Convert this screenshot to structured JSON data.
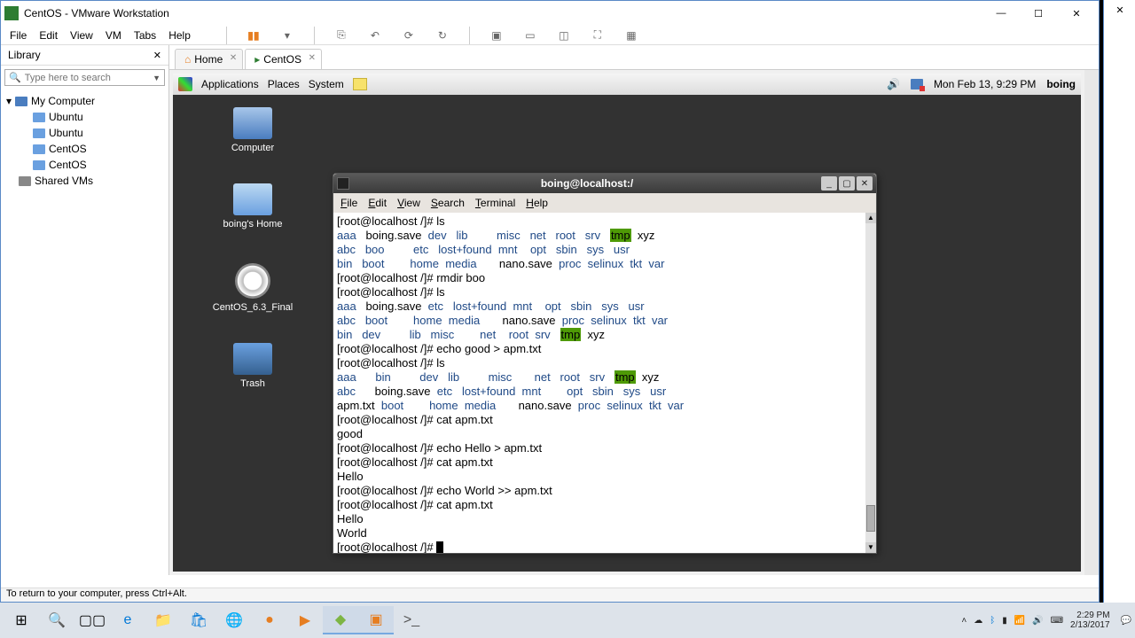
{
  "vmware": {
    "title": "CentOS - VMware Workstation",
    "menu": [
      "File",
      "Edit",
      "View",
      "VM",
      "Tabs",
      "Help"
    ],
    "status": "To return to your computer, press Ctrl+Alt."
  },
  "library": {
    "title": "Library",
    "search_placeholder": "Type here to search",
    "root": "My Computer",
    "items": [
      "Ubuntu",
      "Ubuntu",
      "CentOS",
      "CentOS",
      "Shared VMs"
    ]
  },
  "tabs": {
    "home": "Home",
    "active": "CentOS"
  },
  "gnome": {
    "apps": [
      "Applications",
      "Places",
      "System"
    ],
    "datetime": "Mon Feb 13,  9:29 PM",
    "user": "boing"
  },
  "desktop_icons": {
    "computer": "Computer",
    "home": "boing's Home",
    "disc": "CentOS_6.3_Final",
    "trash": "Trash"
  },
  "terminal": {
    "title": "boing@localhost:/",
    "menu": [
      "File",
      "Edit",
      "View",
      "Search",
      "Terminal",
      "Help"
    ],
    "prompt": "[root@localhost /]# ",
    "cmds": {
      "ls": "ls",
      "rmdir": "rmdir boo",
      "echo_good": "echo good > apm.txt",
      "cat": "cat apm.txt",
      "echo_hello": "echo Hello > apm.txt",
      "echo_world": "echo World >> apm.txt"
    },
    "output": {
      "good": "good",
      "hello": "Hello",
      "world": "World"
    },
    "ls1": {
      "aaa": "aaa",
      "boing_save": "boing.save",
      "dev": "dev",
      "lib": "lib",
      "misc": "misc",
      "net": "net",
      "root": "root",
      "srv": "srv",
      "tmp": "tmp",
      "xyz": "xyz",
      "abc": "abc",
      "boo": "boo",
      "etc": "etc",
      "lostfound": "lost+found",
      "mnt": "mnt",
      "opt": "opt",
      "sbin": "sbin",
      "sys": "sys",
      "usr": "usr",
      "bin": "bin",
      "boot": "boot",
      "home": "home",
      "media": "media",
      "nano_save": "nano.save",
      "proc": "proc",
      "selinux": "selinux",
      "tkt": "tkt",
      "var": "var"
    },
    "ls2": {
      "aaa": "aaa",
      "boing_save": "boing.save",
      "etc": "etc",
      "lostfound": "lost+found",
      "mnt": "mnt",
      "opt": "opt",
      "sbin": "sbin",
      "sys": "sys",
      "usr": "usr",
      "abc": "abc",
      "boot": "boot",
      "home": "home",
      "media": "media",
      "nano_save": "nano.save",
      "proc": "proc",
      "selinux": "selinux",
      "tkt": "tkt",
      "var": "var",
      "bin": "bin",
      "dev": "dev",
      "lib": "lib",
      "misc": "misc",
      "net": "net",
      "root": "root",
      "srv": "srv",
      "tmp": "tmp",
      "xyz": "xyz"
    },
    "ls3": {
      "aaa": "aaa",
      "bin": "bin",
      "dev": "dev",
      "lib": "lib",
      "misc": "misc",
      "net": "net",
      "root": "root",
      "srv": "srv",
      "tmp": "tmp",
      "xyz": "xyz",
      "abc": "abc",
      "boing_save": "boing.save",
      "etc": "etc",
      "lostfound": "lost+found",
      "mnt": "mnt",
      "opt": "opt",
      "sbin": "sbin",
      "sys": "sys",
      "usr": "usr",
      "apm": "apm.txt",
      "boot": "boot",
      "home": "home",
      "media": "media",
      "nano_save": "nano.save",
      "proc": "proc",
      "selinux": "selinux",
      "tkt": "tkt",
      "var": "var"
    }
  },
  "windows": {
    "time": "2:29 PM",
    "date": "2/13/2017"
  }
}
